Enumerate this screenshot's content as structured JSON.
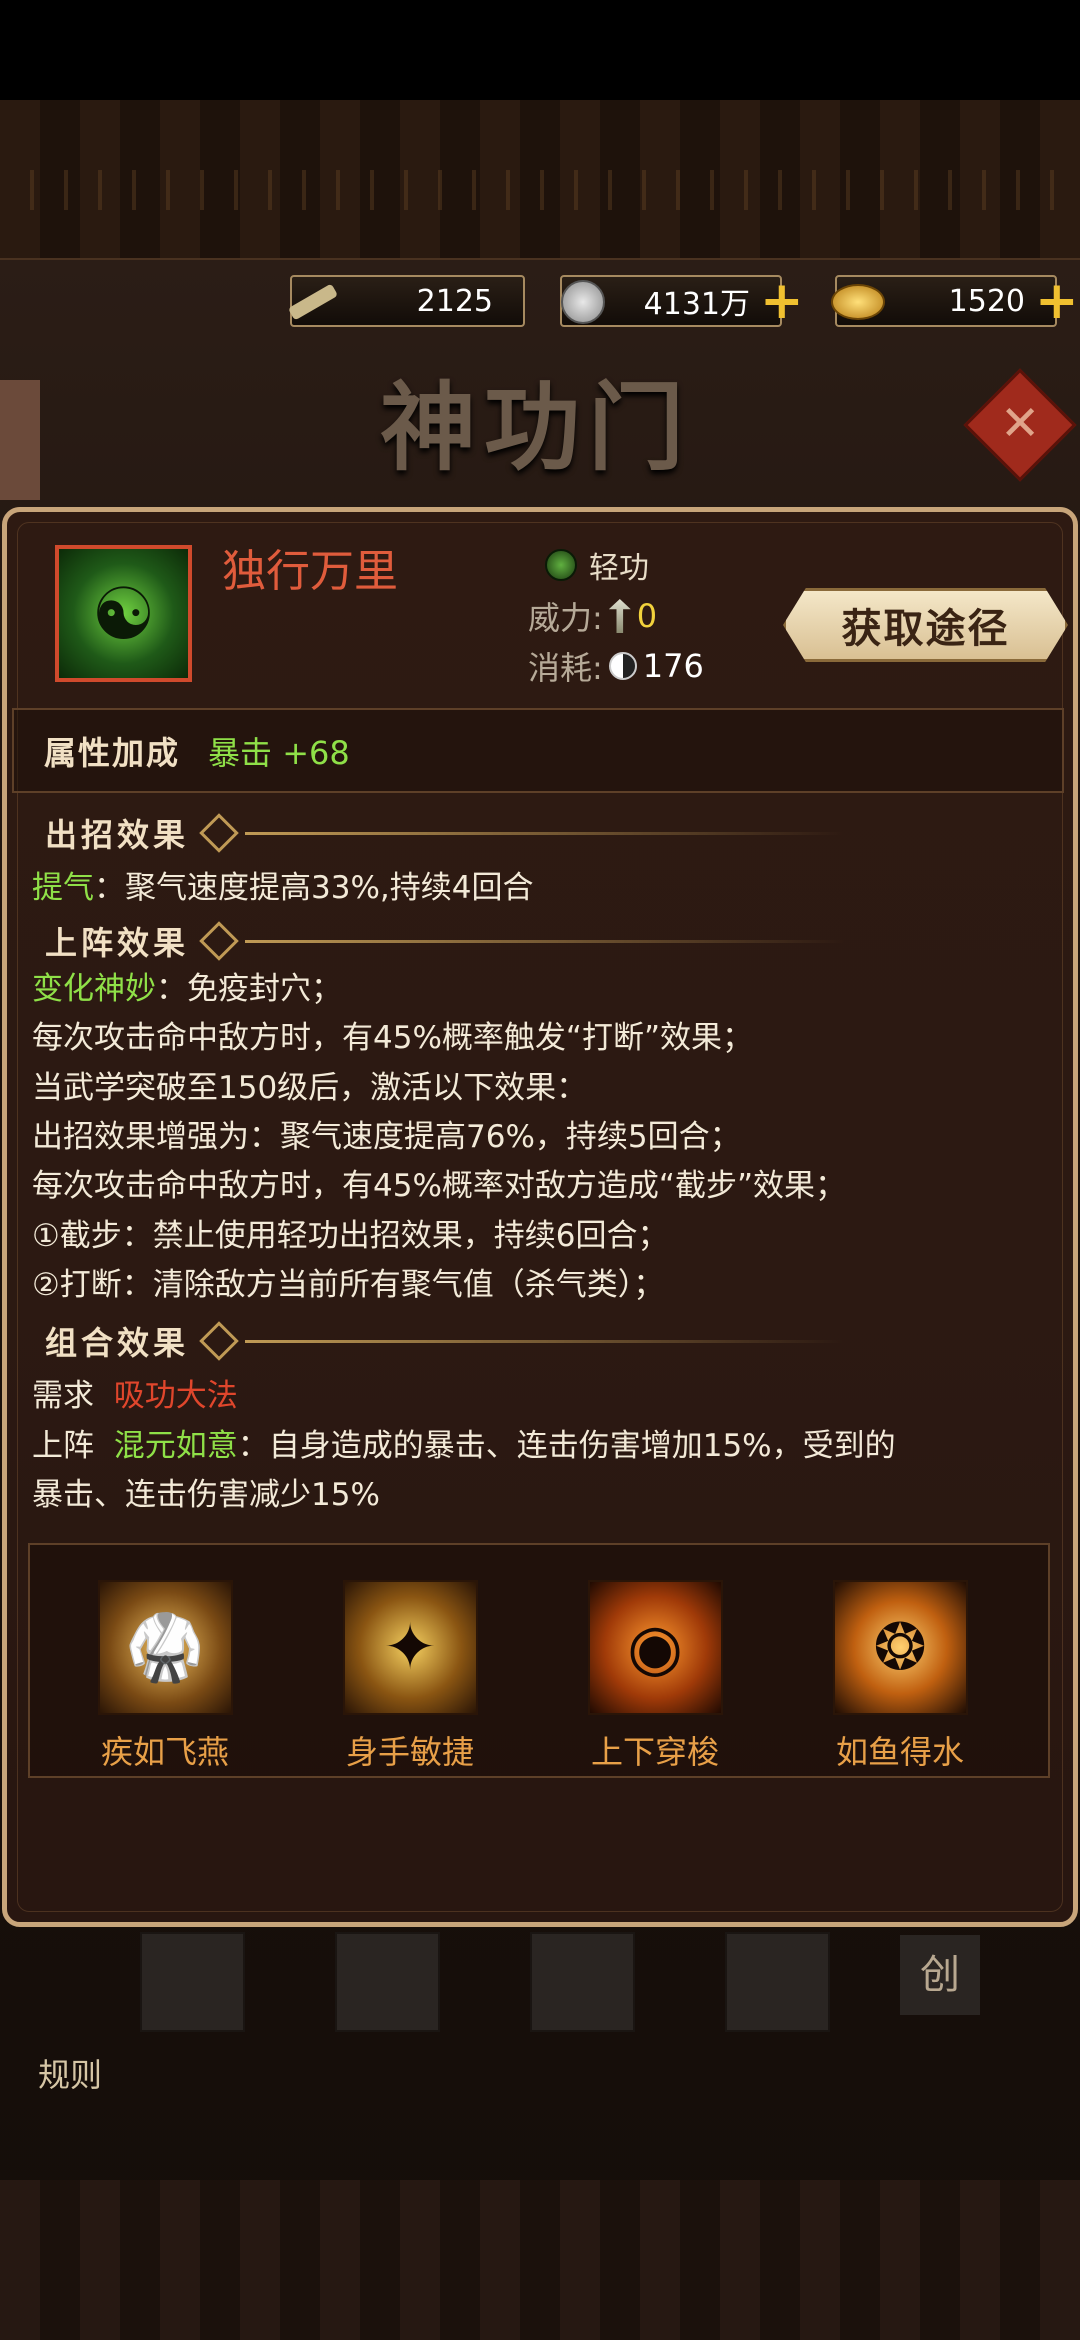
{
  "currency": {
    "scroll_value": "2125",
    "silver_value": "4131万",
    "gold_value": "1520"
  },
  "banner": {
    "title": "神功门"
  },
  "skill": {
    "name": "独行万里",
    "type": "轻功",
    "power_label": "威力:",
    "power_value": "0",
    "cost_label": "消耗:",
    "cost_value": "176",
    "acquire_button": "获取途径"
  },
  "attributes": {
    "title": "属性加成",
    "value": "暴击 +68"
  },
  "move_effect": {
    "title": "出招效果",
    "label": "提气",
    "text": "：聚气速度提高33%,持续4回合"
  },
  "deploy_effect": {
    "title": "上阵效果",
    "label": "变化神妙",
    "text": "：免疫封穴；",
    "lines": [
      "每次攻击命中敌方时，有45%概率触发“打断”效果；",
      "当武学突破至150级后，激活以下效果：",
      "出招效果增强为：聚气速度提高76%，持续5回合；",
      "每次攻击命中敌方时，有45%概率对敌方造成“截步”效果；",
      "①截步：禁止使用轻功出招效果，持续6回合；",
      "②打断：清除敌方当前所有聚气值（杀气类）；"
    ]
  },
  "combo_effect": {
    "title": "组合效果",
    "require_label": "需求",
    "require_value": "吸功大法",
    "deploy_label": "上阵",
    "deploy_name": "混元如意",
    "deploy_text": "：自身造成的暴击、连击伤害增加15%，受到的",
    "deploy_text2": "暴击、连击伤害减少15%"
  },
  "combos": [
    {
      "name": "疾如飞燕"
    },
    {
      "name": "身手敏捷"
    },
    {
      "name": "上下穿梭"
    },
    {
      "name": "如鱼得水"
    }
  ],
  "bottom": {
    "rules_label": "规则",
    "create_label": "创"
  },
  "colors": {
    "accent_gold": "#c09a55",
    "skill_name_red": "#e05c3c",
    "effect_green": "#8fe048",
    "combo_orange": "#e8a048"
  }
}
